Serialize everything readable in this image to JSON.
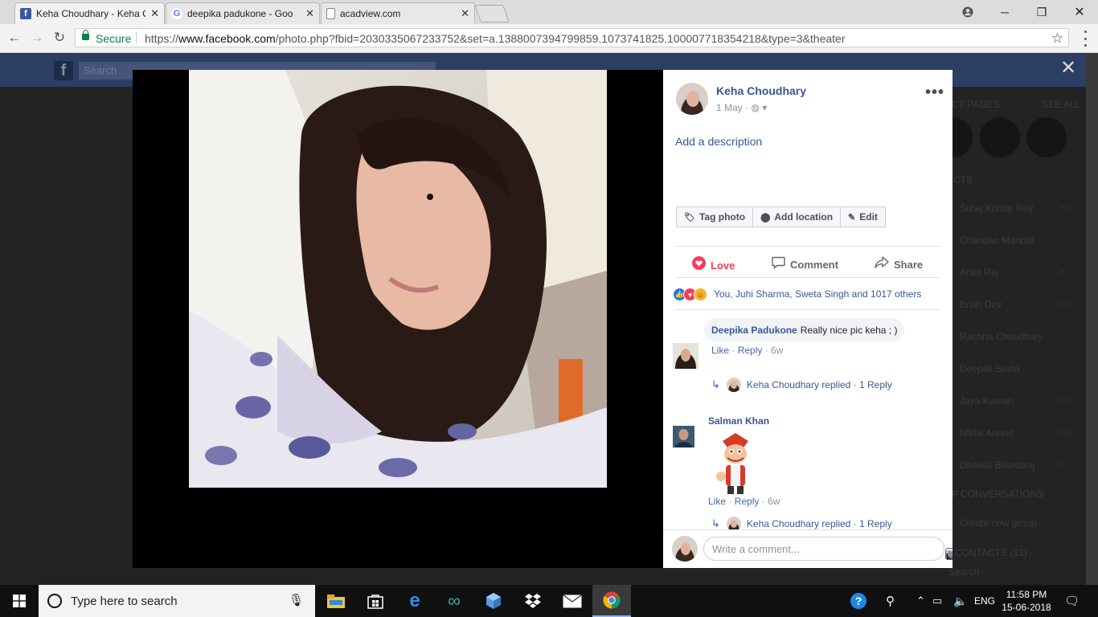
{
  "browser": {
    "tabs": [
      {
        "title": "Keha Choudhary - Keha C",
        "favicon": "facebook-icon"
      },
      {
        "title": "deepika padukone - Goo",
        "favicon": "google-icon"
      },
      {
        "title": "acadview.com",
        "favicon": "page-icon"
      }
    ],
    "secure_label": "Secure",
    "url_scheme": "https://",
    "url_host": "www.facebook.com",
    "url_path": "/photo.php?fbid=2030335067233752&set=a.1388007394799859.1073741825.100007718354218&type=3&theater"
  },
  "facebook_bg": {
    "logo": "f",
    "search_placeholder": "Search",
    "right_header_1": "CT PAGES",
    "right_header_2": "SEE ALL",
    "contacts_header": "CTS",
    "contacts": [
      {
        "name": "Suraj Kumar Roy",
        "time": "45m"
      },
      {
        "name": "Chandan Mandal",
        "time": ""
      },
      {
        "name": "Ankit Raj",
        "time": "3h"
      },
      {
        "name": "Brish Dev",
        "time": "53m"
      },
      {
        "name": "Rachna Chaudhary",
        "time": ""
      },
      {
        "name": "Deepali Sinha",
        "time": ""
      },
      {
        "name": "Jaya Kumari",
        "time": "42m"
      },
      {
        "name": "Nikhil Anand",
        "time": "15m"
      },
      {
        "name": "Dhawal Bhardwaj",
        "time": "1h"
      }
    ],
    "group_header": "P CONVERSATIONS",
    "create_group": "Create new group",
    "more_contacts": "CONTACTS (13)",
    "bottom_search": "Search"
  },
  "post": {
    "author": "Keha Choudhary",
    "date": "1 May",
    "add_description": "Add a description",
    "buttons": {
      "tag": "Tag photo",
      "location": "Add location",
      "edit": "Edit"
    },
    "actions": {
      "love": "Love",
      "comment": "Comment",
      "share": "Share"
    },
    "reactions_text": "You, Juhi Sharma, Sweta Singh and 1017 others",
    "comments": [
      {
        "name": "Deepika Padukone",
        "text": "Really nice pic keha ; )",
        "like": "Like",
        "reply": "Reply",
        "age": "6w",
        "reply_author": "Keha Choudhary replied",
        "reply_count": "1 Reply"
      },
      {
        "name": "Salman Khan",
        "text": "",
        "like": "Like",
        "reply": "Reply",
        "age": "6w",
        "reply_author": "Keha Choudhary replied",
        "reply_count": "1 Reply"
      }
    ],
    "composer_placeholder": "Write a comment..."
  },
  "taskbar": {
    "search_placeholder": "Type here to search",
    "language": "ENG",
    "time": "11:58 PM",
    "date": "15-06-2018"
  }
}
